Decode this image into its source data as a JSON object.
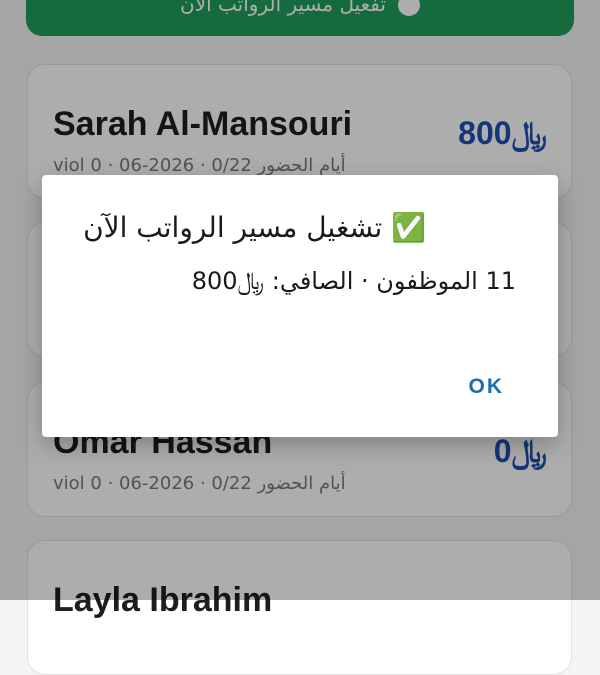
{
  "top_button": {
    "label": "تفعيل مسير الرواتب الآن"
  },
  "employees": [
    {
      "name": "Sarah Al-Mansouri",
      "meta": "viol 0 · أيام الحضور 0/22 · 2026-06",
      "amount": "800﷼"
    },
    {
      "name": "",
      "meta": "",
      "amount": ""
    },
    {
      "name": "Omar Hassan",
      "meta": "viol 0 · أيام الحضور 0/22 · 2026-06",
      "amount": "0﷼"
    },
    {
      "name": "Layla Ibrahim",
      "meta": "",
      "amount": ""
    }
  ],
  "dialog": {
    "title": "✅ تشغيل مسير الرواتب الآن",
    "message": "11 الموظفون · الصافي: ﷼800",
    "ok_label": "OK"
  },
  "colors": {
    "accent_green": "#1f9e5a",
    "amount_blue": "#1e4fb0",
    "ok_blue": "#1e6fa8"
  }
}
